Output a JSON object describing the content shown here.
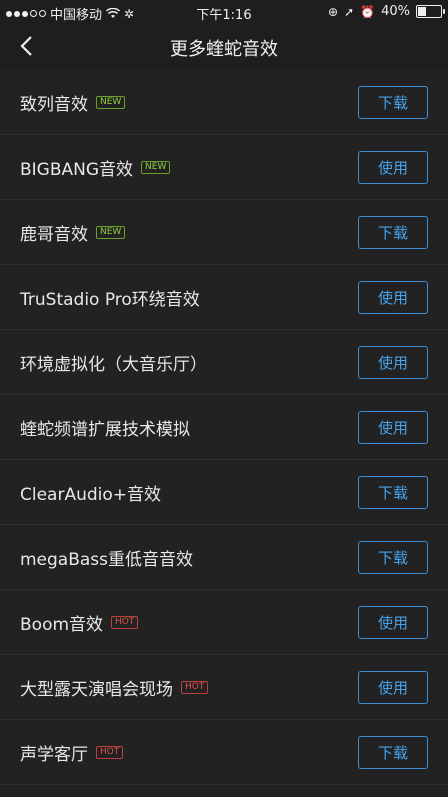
{
  "status_bar": {
    "carrier": "中国移动",
    "time": "下午1:16",
    "battery_text": "40%",
    "battery_level": 0.4
  },
  "nav": {
    "title": "更多蝰蛇音效"
  },
  "items": [
    {
      "label": "致列音效",
      "tag": "NEW",
      "tag_type": "new",
      "action": "下载"
    },
    {
      "label": "BIGBANG音效",
      "tag": "NEW",
      "tag_type": "new",
      "action": "使用"
    },
    {
      "label": "鹿哥音效",
      "tag": "NEW",
      "tag_type": "new",
      "action": "下载"
    },
    {
      "label": "TruStadio Pro环绕音效",
      "tag": "",
      "tag_type": "",
      "action": "使用"
    },
    {
      "label": "环境虚拟化（大音乐厅）",
      "tag": "",
      "tag_type": "",
      "action": "使用"
    },
    {
      "label": "蝰蛇频谱扩展技术模拟",
      "tag": "",
      "tag_type": "",
      "action": "使用"
    },
    {
      "label": "ClearAudio+音效",
      "tag": "",
      "tag_type": "",
      "action": "下载"
    },
    {
      "label": "megaBass重低音音效",
      "tag": "",
      "tag_type": "",
      "action": "下载"
    },
    {
      "label": "Boom音效",
      "tag": "HOT",
      "tag_type": "hot",
      "action": "使用"
    },
    {
      "label": "大型露天演唱会现场",
      "tag": "HOT",
      "tag_type": "hot",
      "action": "使用"
    },
    {
      "label": "声学客厅",
      "tag": "HOT",
      "tag_type": "hot",
      "action": "下载"
    }
  ],
  "colors": {
    "background": "#1e1e1e",
    "list_background": "#222222",
    "accent": "#47a2ea",
    "new_tag": "#8fcf3b",
    "hot_tag": "#e0524a"
  }
}
